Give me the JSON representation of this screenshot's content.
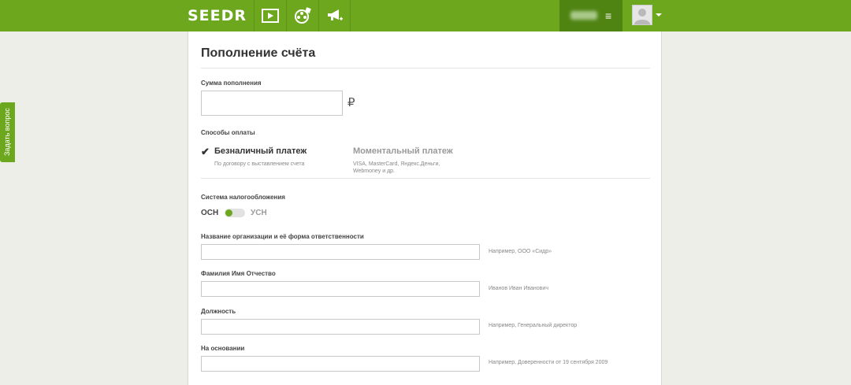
{
  "header": {
    "logo": "SEEDR",
    "nav_icons": [
      "play-icon",
      "film-reel-icon",
      "megaphone-icon"
    ],
    "menu_icon": "≡"
  },
  "side_tab": {
    "label": "Задать вопрос"
  },
  "form": {
    "title": "Пополнение счёта",
    "amount_label": "Сумма пополнения",
    "amount_value": "",
    "currency": "₽",
    "payment_methods_label": "Способы оплаты",
    "payment_methods": [
      {
        "title": "Безналичный платеж",
        "desc": "По договору с выставлением счета",
        "selected": true
      },
      {
        "title": "Моментальный платеж",
        "desc": "VISA, MasterCard, Яндекс.Деньги, Webmoney и др.",
        "selected": false
      }
    ],
    "tax_system_label": "Система налогообложения",
    "tax_options": [
      "ОСН",
      "УСН"
    ],
    "fields": [
      {
        "label": "Название организации и её форма ответственности",
        "value": "",
        "hint": "Например, ООО «Сидр»"
      },
      {
        "label": "Фамилия Имя Отчество",
        "value": "",
        "hint": "Иванов Иван Иванович"
      },
      {
        "label": "Должность",
        "value": "",
        "hint": "Например, Генеральный директор"
      },
      {
        "label": "На основании",
        "value": "",
        "hint": "Например, Доверенности от 19 сентября 2009"
      }
    ]
  },
  "colors": {
    "brand_green": "#6da71e",
    "user_zone": "#4f8413",
    "background": "#eeeee9"
  }
}
